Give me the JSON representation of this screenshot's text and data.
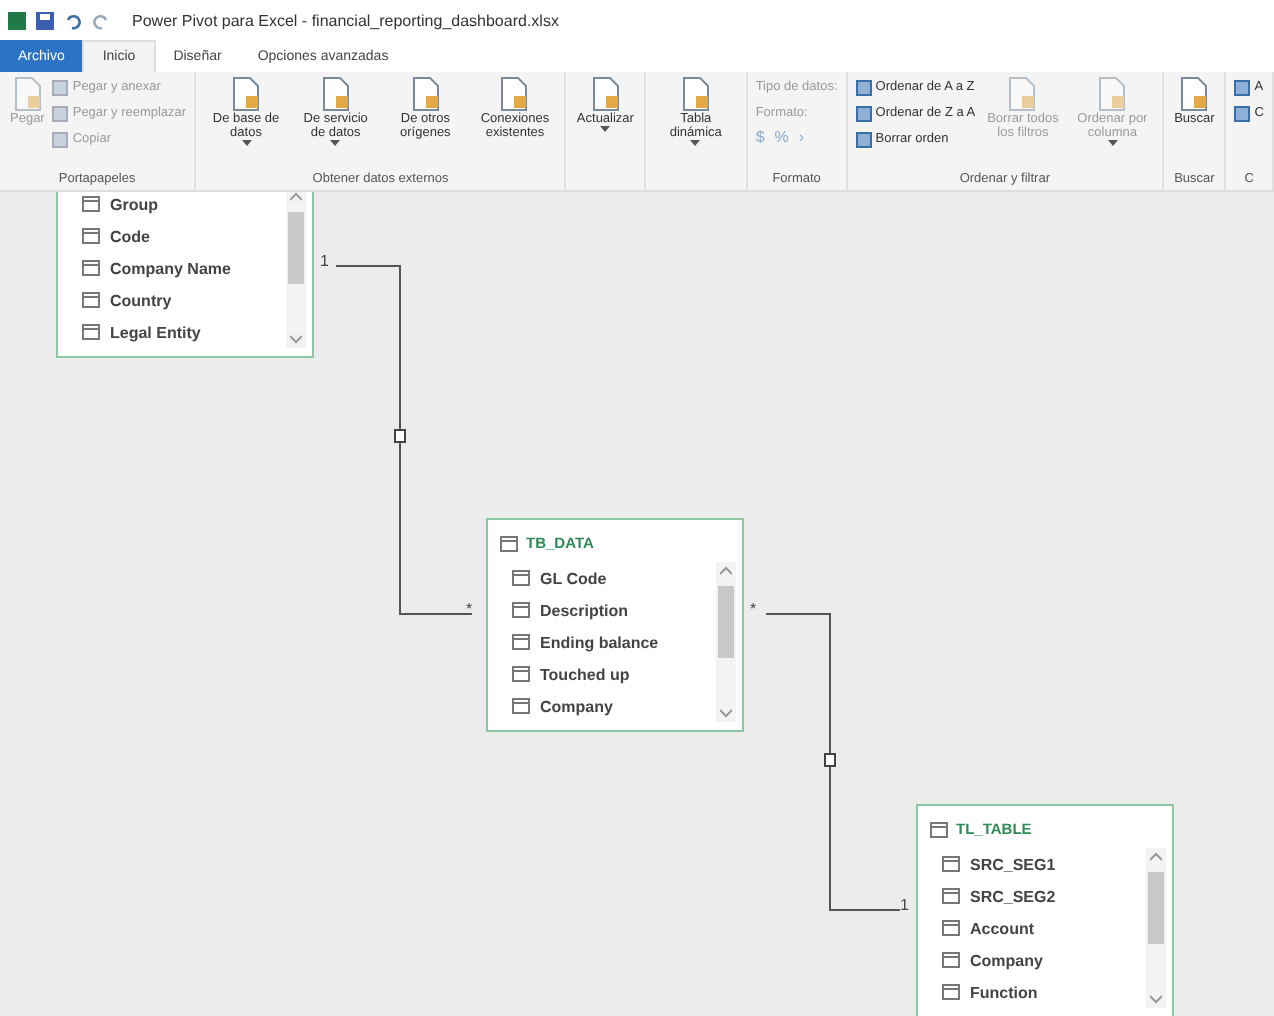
{
  "title_bar": {
    "title": "Power Pivot para Excel - financial_reporting_dashboard.xlsx"
  },
  "tabs": [
    {
      "label": "Archivo",
      "kind": "file",
      "selected": false
    },
    {
      "label": "Inicio",
      "kind": "tab",
      "selected": true
    },
    {
      "label": "Diseñar",
      "kind": "tab",
      "selected": false
    },
    {
      "label": "Opciones avanzadas",
      "kind": "tab",
      "selected": false
    }
  ],
  "ribbon": {
    "groups": [
      {
        "label": "Portapapeles",
        "columns": [
          [
            {
              "kind": "large",
              "label": "Pegar",
              "disabled": true
            }
          ],
          [
            {
              "kind": "small",
              "label": "Pegar y anexar",
              "disabled": true
            },
            {
              "kind": "small",
              "label": "Pegar y reemplazar",
              "disabled": true
            },
            {
              "kind": "small",
              "label": "Copiar",
              "disabled": true
            }
          ]
        ]
      },
      {
        "label": "Obtener datos externos",
        "columns": [
          [
            {
              "kind": "large",
              "label": "De base de datos",
              "dropdown": true,
              "disabled": false
            }
          ],
          [
            {
              "kind": "large",
              "label": "De servicio de datos",
              "dropdown": true,
              "disabled": false
            }
          ],
          [
            {
              "kind": "large",
              "label": "De otros orígenes",
              "dropdown": false,
              "disabled": false
            }
          ],
          [
            {
              "kind": "large",
              "label": "Conexiones existentes",
              "dropdown": false,
              "disabled": false
            }
          ]
        ]
      },
      {
        "columns": [
          [
            {
              "kind": "large",
              "label": "Actualizar",
              "dropdown": true,
              "disabled": false
            }
          ]
        ]
      },
      {
        "columns": [
          [
            {
              "kind": "large",
              "label": "Tabla dinámica",
              "dropdown": true,
              "disabled": false
            }
          ]
        ]
      },
      {
        "label": "Formato",
        "columns": [
          [
            {
              "kind": "field",
              "label": "Tipo de datos:",
              "disabled": true
            },
            {
              "kind": "field",
              "label": "Formato:",
              "disabled": true
            },
            {
              "kind": "symbols",
              "symbols": [
                "$",
                "%",
                "›"
              ],
              "disabled": true
            }
          ]
        ]
      },
      {
        "label": "Ordenar y filtrar",
        "columns": [
          [
            {
              "kind": "small",
              "label": "Ordenar de A a Z",
              "disabled": false
            },
            {
              "kind": "small",
              "label": "Ordenar de Z a A",
              "disabled": false
            },
            {
              "kind": "small",
              "label": "Borrar orden",
              "disabled": false
            }
          ],
          [
            {
              "kind": "large",
              "label": "Borrar todos los filtros",
              "dropdown": false,
              "disabled": true
            }
          ],
          [
            {
              "kind": "large",
              "label": "Ordenar por columna",
              "dropdown": true,
              "disabled": true
            }
          ]
        ]
      },
      {
        "label": "Buscar",
        "columns": [
          [
            {
              "kind": "large",
              "label": "Buscar",
              "dropdown": false,
              "disabled": false
            }
          ]
        ]
      },
      {
        "label": "C",
        "columns": [
          [
            {
              "kind": "small",
              "label": "A",
              "disabled": false
            },
            {
              "kind": "small",
              "label": "C",
              "disabled": false
            }
          ]
        ]
      }
    ]
  },
  "diagram": {
    "tables": [
      {
        "fields": [
          "Group",
          "Code",
          "Company Name",
          "Country",
          "Legal Entity"
        ]
      },
      {
        "title": "TB_DATA",
        "fields": [
          "GL Code",
          "Description",
          "Ending balance",
          "Touched up",
          "Company"
        ]
      },
      {
        "title": "TL_TABLE",
        "fields": [
          "SRC_SEG1",
          "SRC_SEG2",
          "Account",
          "Company",
          "Function"
        ]
      }
    ],
    "relationships": [
      {
        "from_label": "1",
        "to_label": "*"
      },
      {
        "from_label": "*",
        "to_label": "1"
      }
    ]
  }
}
